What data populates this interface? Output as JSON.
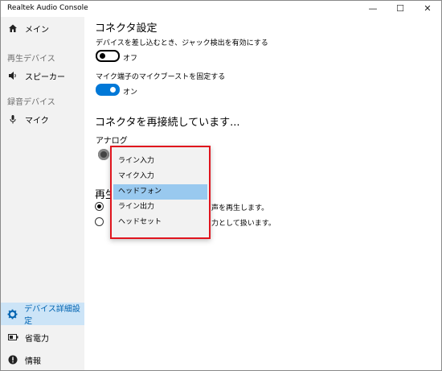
{
  "window": {
    "title": "Realtek Audio Console"
  },
  "titlebar": {
    "minimize": "—",
    "maximize": "☐",
    "close": "✕"
  },
  "sidebar": {
    "main": "メイン",
    "playback_section": "再生デバイス",
    "speaker": "スピーカー",
    "record_section": "録音デバイス",
    "mic": "マイク",
    "device_settings": "デバイス詳細設定",
    "power": "省電力",
    "info": "情報"
  },
  "connector": {
    "title": "コネクタ設定",
    "jack_detect_label": "デバイスを差し込むとき、ジャック検出を有効にする",
    "jack_detect_state": "オフ",
    "mic_boost_label": "マイク端子のマイクブーストを固定する",
    "mic_boost_state": "オン",
    "reconnect_title": "コネクタを再接続しています...",
    "analog_label": "アナログ"
  },
  "playback": {
    "section_title_partial": "再生",
    "option1_partial": "声を再生します。",
    "option2_partial": "力として扱います。"
  },
  "dropdown": {
    "options": [
      "ライン入力",
      "マイク入力",
      "ヘッドフォン",
      "ライン出力",
      "ヘッドセット"
    ],
    "selected_index": 2
  }
}
